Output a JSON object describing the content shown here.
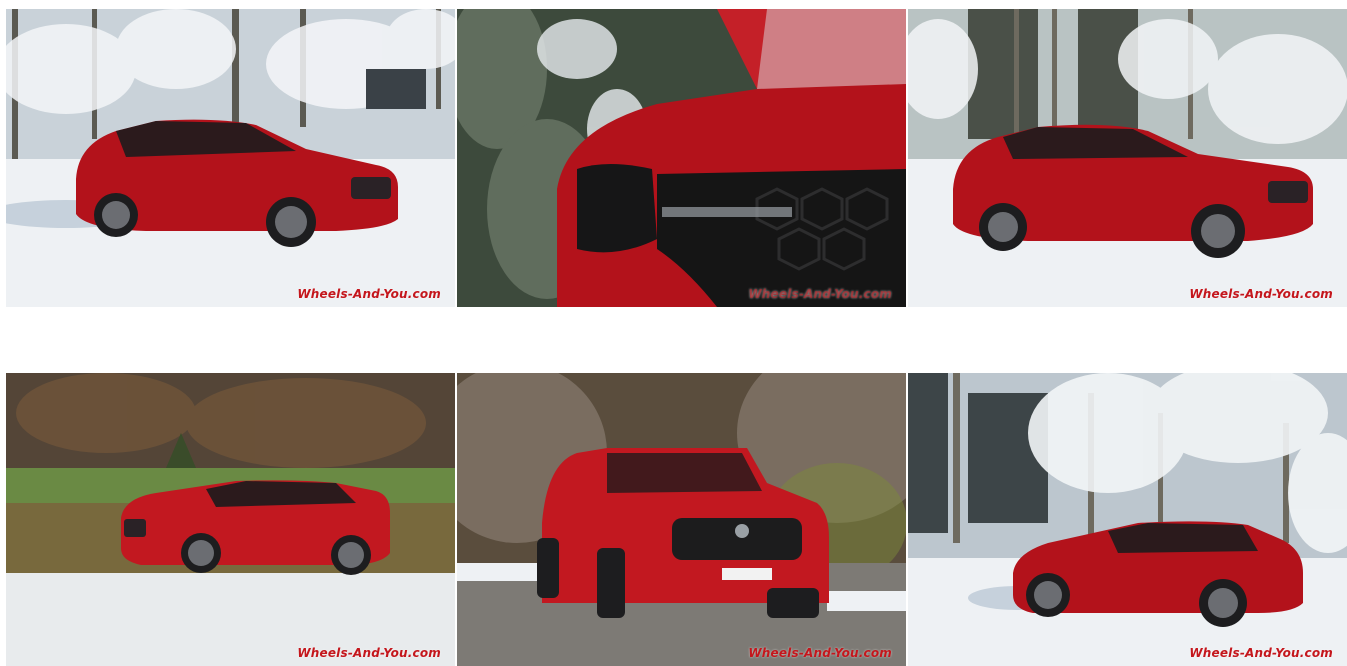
{
  "gallery": {
    "watermark": "Wheels-And-You.com",
    "photos": [
      {
        "scene": "snowy-forest",
        "subject": "red-suv-front-three-quarter"
      },
      {
        "scene": "snowy-forest",
        "subject": "red-suv-headlight-closeup"
      },
      {
        "scene": "snowy-forest",
        "subject": "red-suv-front-three-quarter"
      },
      {
        "scene": "autumn-meadow",
        "subject": "red-suv-side-moving"
      },
      {
        "scene": "autumn-forest",
        "subject": "red-suv-front"
      },
      {
        "scene": "snowy-forest",
        "subject": "red-suv-rear-three-quarter"
      }
    ]
  },
  "colors": {
    "car_red": "#b3121b",
    "watermark_red": "#c4161c",
    "snow": "#eef1f4",
    "background": "#ffffff"
  }
}
